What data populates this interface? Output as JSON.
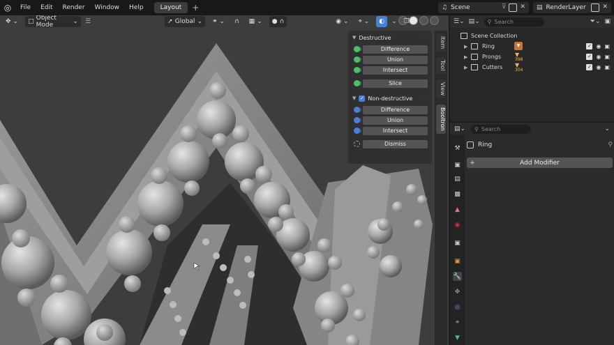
{
  "topbar": {
    "menus": [
      "File",
      "Edit",
      "Render",
      "Window",
      "Help"
    ],
    "workspace_tab": "Layout",
    "add_tab": "+",
    "scene": "Scene",
    "render_layer": "RenderLayer"
  },
  "viewport": {
    "mode": "Object Mode",
    "orientation": "Global",
    "side_tabs": [
      "Item",
      "Tool",
      "View",
      "Booltron"
    ]
  },
  "booltron": {
    "destructive_title": "Destructive",
    "destructive_buttons": [
      "Difference",
      "Union",
      "Intersect",
      "Slice"
    ],
    "nondestructive_title": "Non-destructive",
    "nondestructive_buttons": [
      "Difference",
      "Union",
      "Intersect",
      "Dismiss"
    ]
  },
  "outliner": {
    "search_placeholder": "Search",
    "collection": "Scene Collection",
    "items": [
      {
        "name": "Ring",
        "count": ""
      },
      {
        "name": "Prongs",
        "count": "398"
      },
      {
        "name": "Cutters",
        "count": "304"
      }
    ]
  },
  "properties": {
    "search_placeholder": "Search",
    "object_name": "Ring",
    "add_modifier": "Add Modifier"
  },
  "colors": {
    "accent_blue": "#4a7fd8",
    "green_icon": "#4fbd6d",
    "orange_badge": "#c2773a"
  }
}
